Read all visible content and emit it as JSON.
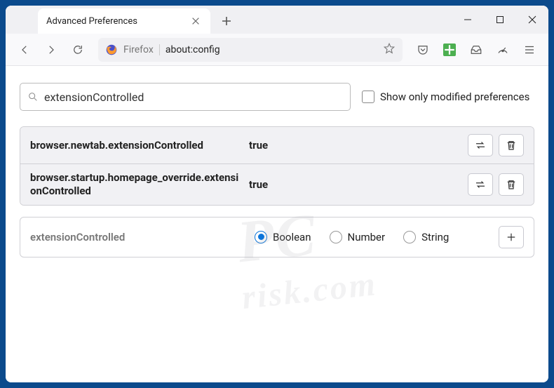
{
  "window": {
    "tab_title": "Advanced Preferences"
  },
  "addressbar": {
    "firefox_label": "Firefox",
    "url": "about:config"
  },
  "search": {
    "value": "extensionControlled",
    "modified_only_label": "Show only modified preferences"
  },
  "prefs": [
    {
      "key": "browser.newtab.extensionControlled",
      "value": "true"
    },
    {
      "key": "browser.startup.homepage_override.extensionControlled",
      "value": "true"
    }
  ],
  "newpref": {
    "name": "extensionControlled",
    "types": {
      "boolean": "Boolean",
      "number": "Number",
      "string": "String"
    },
    "selected": "boolean"
  },
  "watermark": {
    "main": "PC",
    "sub": "risk.com"
  }
}
